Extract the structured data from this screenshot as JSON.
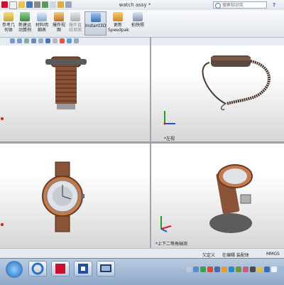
{
  "window": {
    "title": "watch assy *"
  },
  "search": {
    "placeholder": "搜索知识库"
  },
  "help_glyph": "?",
  "ribbon": {
    "buttons": [
      {
        "label": "参考几\n何体",
        "icon": "reference-geometry-icon"
      },
      {
        "label": "新建运\n动算例",
        "icon": "new-motion-study-icon"
      },
      {
        "label": "材料明\n细表",
        "icon": "bill-of-materials-icon"
      },
      {
        "label": "爆炸视\n图",
        "icon": "exploded-view-icon"
      },
      {
        "label": "爆炸直\n线草图",
        "icon": "explode-line-sketch-icon"
      },
      {
        "label": "Instant3D",
        "icon": "instant3d-icon",
        "active": true
      },
      {
        "label": "更新\nSpeedpak",
        "icon": "update-speedpak-icon"
      },
      {
        "label": "拍快照",
        "icon": "snapshot-icon"
      }
    ]
  },
  "viewports": {
    "top_left": {
      "label": ""
    },
    "top_right": {
      "label": "*左视"
    },
    "bottom_left": {
      "label": ""
    },
    "bottom_right": {
      "label": "*上下二等角轴测"
    }
  },
  "status": {
    "custom": "欠定义",
    "editing": "在编辑 装配体",
    "units": "MMGS"
  },
  "colors": {
    "accent": "#4a76b8",
    "watch_bronze": "#b06d44",
    "watch_dark": "#4a3226",
    "axis_red": "#d42020",
    "axis_green": "#2a9a2a",
    "axis_blue": "#2a4fd0"
  }
}
